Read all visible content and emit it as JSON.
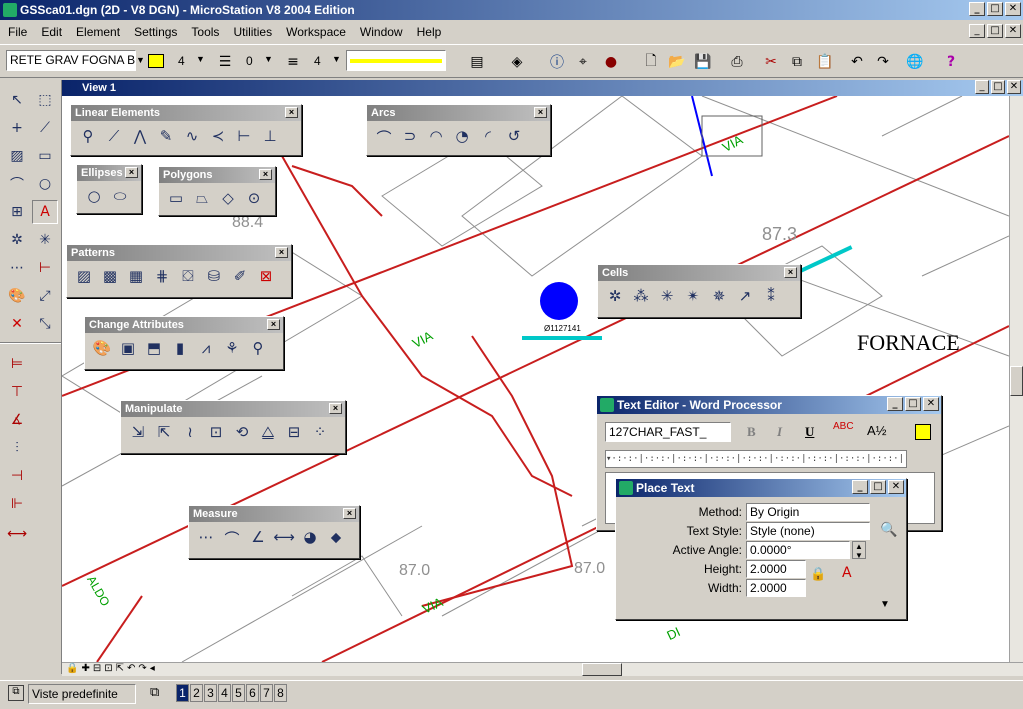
{
  "app": {
    "title": "GSSca01.dgn (2D - V8 DGN) - MicroStation V8 2004 Edition",
    "window_controls": [
      "_",
      "□",
      "✕"
    ]
  },
  "menu": [
    "File",
    "Edit",
    "Element",
    "Settings",
    "Tools",
    "Utilities",
    "Workspace",
    "Window",
    "Help"
  ],
  "toolbar": {
    "level": "RETE GRAV FOGNA B",
    "color_index": "4",
    "style": "0",
    "weight": "4",
    "active_color": "#ffff00"
  },
  "view": {
    "title": "View 1"
  },
  "map": {
    "labels": [
      {
        "text": "88.4"
      },
      {
        "text": "87.3"
      },
      {
        "text": "FORNACE"
      },
      {
        "text": "87.0"
      },
      {
        "text": "87.0"
      },
      {
        "text": "Ø1127141"
      },
      {
        "text": "VIA"
      },
      {
        "text": "VIA"
      },
      {
        "text": "VIA"
      },
      {
        "text": "DI"
      },
      {
        "text": "ALDO"
      }
    ],
    "colors": {
      "road": "#c81e1e",
      "cadastre": "#909090",
      "blue": "#0000ff",
      "green": "#00a000",
      "cyan": "#00c8c8"
    }
  },
  "palettes": {
    "linear": {
      "title": "Linear Elements"
    },
    "arcs": {
      "title": "Arcs"
    },
    "ellipses": {
      "title": "Ellipses"
    },
    "polygons": {
      "title": "Polygons"
    },
    "patterns": {
      "title": "Patterns"
    },
    "change": {
      "title": "Change Attributes"
    },
    "manipulate": {
      "title": "Manipulate"
    },
    "measure": {
      "title": "Measure"
    },
    "cells": {
      "title": "Cells"
    }
  },
  "text_editor": {
    "title": "Text Editor - Word Processor",
    "font": "127CHAR_FAST_",
    "bold": "B",
    "italic": "I",
    "underline": "U",
    "spell": "ABC",
    "fraction": "A½"
  },
  "place_text": {
    "title": "Place Text",
    "method_label": "Method:",
    "method_value": "By Origin",
    "style_label": "Text Style:",
    "style_value": "Style (none)",
    "angle_label": "Active Angle:",
    "angle_value": "0.0000°",
    "height_label": "Height:",
    "height_value": "2.0000",
    "width_label": "Width:",
    "width_value": "2.0000"
  },
  "status": {
    "view_set": "Viste predefinite",
    "views": [
      "1",
      "2",
      "3",
      "4",
      "5",
      "6",
      "7",
      "8"
    ]
  }
}
